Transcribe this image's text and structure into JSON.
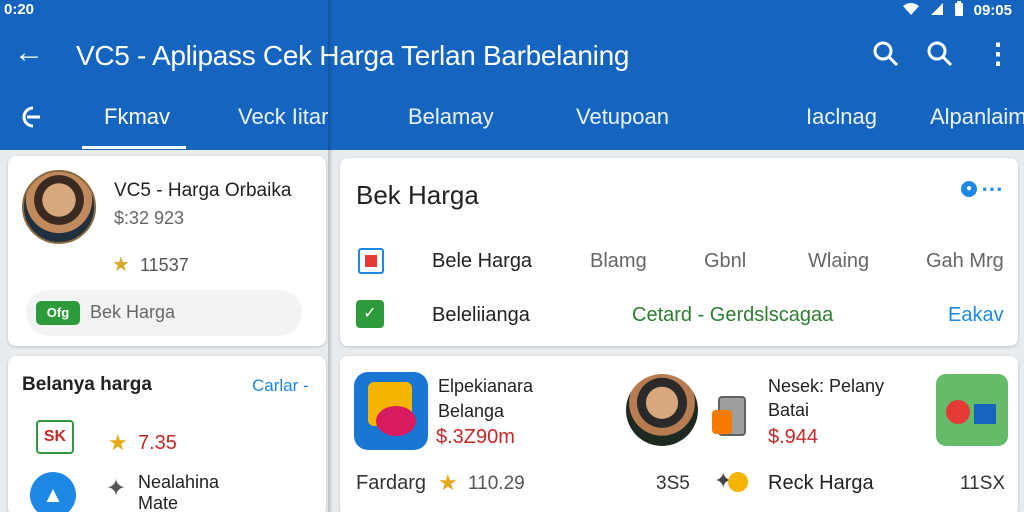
{
  "status_bar": {
    "left": "0:20",
    "right_icons": [
      "wifi-icon",
      "signal-icon",
      "battery-icon"
    ],
    "time": "09:05"
  },
  "toolbar": {
    "title": "VC5 - Aplipass Cek Harga Terlan Barbelaning",
    "actions": [
      "search-icon",
      "search-icon",
      "overflow-icon"
    ]
  },
  "tabs": [
    {
      "label": "Fkmav",
      "active": true
    },
    {
      "label": "Veck Iitar",
      "active": false
    },
    {
      "label": "Belamay",
      "active": false
    },
    {
      "label": "Vetupoan",
      "active": false
    },
    {
      "label": "Iaclnag",
      "active": false
    },
    {
      "label": "Alpanlaim",
      "active": false
    }
  ],
  "profile_card": {
    "name": "VC5 - Harga Orbaika",
    "price": "$:32 923",
    "rating": "11537",
    "chip_badge": "Ofg",
    "chip_label": "Bek Harga"
  },
  "list_card": {
    "heading": "Belanya harga",
    "link": "Carlar -",
    "row1": {
      "badge": "SK",
      "value": "7.35"
    },
    "row2": {
      "line1": "Nealahina",
      "line2": "Mate"
    }
  },
  "main_card": {
    "title": "Bek Harga",
    "row1": {
      "label": "Bele Harga",
      "columns": [
        "Blamg",
        "Gbnl",
        "Wlaing",
        "Gah Mrg"
      ]
    },
    "row2": {
      "label": "Beleliianga",
      "green_text": "Cetard - Gerdslscagaa",
      "link": "Eakav"
    }
  },
  "products_card": {
    "product1": {
      "name_line1": "Elpekianara",
      "name_line2": "Belanga",
      "price": "$.3Z90m"
    },
    "product3": {
      "name_line1": "Nesek: Pelany",
      "name_line2": "Batai",
      "price": "$.944"
    },
    "footer": {
      "label": "Fardarg",
      "rating": "110.29",
      "count": "3S5",
      "link": "Reck Harga",
      "right": "11SX"
    }
  },
  "colors": {
    "primary": "#1565c0",
    "accent": "#1e88e5",
    "price_red": "#c62828",
    "green": "#2e7d32",
    "star": "#e6a817"
  }
}
